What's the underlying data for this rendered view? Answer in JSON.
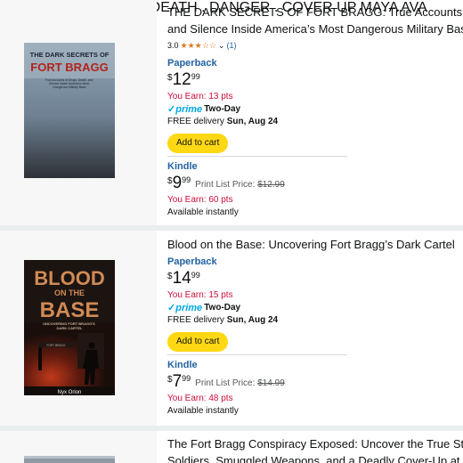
{
  "results": [
    {
      "title": "THE DARK SECRETS OF FORT BRAGG: True Accounts of Dru",
      "title_line2": "and Silence Inside America’s Most Dangerous Military Base",
      "rating": "3.0",
      "review_count": "(1)",
      "cover": {
        "title_line1": "THE DARK SECRETS OF",
        "title_line2": "FORT BRAGG",
        "subtitle": "True Accounts of Drugs, Death, and Silence Inside America's Most Dangerous Military Base",
        "tape_text": "TRESPASS SECRETS DEATH . DANGER . COVER UP",
        "author": "MAYA AVA BENNETT"
      },
      "paperback": {
        "label": "Paperback",
        "currency": "$",
        "whole": "12",
        "fraction": "99",
        "earn": "You Earn: 13 pts",
        "prime_word": "prime",
        "prime_label": "Two-Day",
        "delivery_prefix": "FREE delivery",
        "delivery_date": "Sun, Aug 24",
        "cart_label": "Add to cart"
      },
      "kindle": {
        "label": "Kindle",
        "currency": "$",
        "whole": "9",
        "fraction": "99",
        "list_price_label": "Print List Price:",
        "list_price": "$12.99",
        "earn": "You Earn: 60 pts",
        "availability": "Available instantly"
      }
    },
    {
      "title": "Blood on the Base: Uncovering Fort Bragg’s Dark Cartel",
      "cover": {
        "title_line1": "BLOOD",
        "title_line2": "ON THE",
        "title_line3": "BASE",
        "subtitle": "UNCOVERING FORT BRAGG'S DARK CARTEL",
        "sign": "FORT BRAGG",
        "author": "Nyx Orion"
      },
      "paperback": {
        "label": "Paperback",
        "currency": "$",
        "whole": "14",
        "fraction": "99",
        "earn": "You Earn: 15 pts",
        "prime_word": "prime",
        "prime_label": "Two-Day",
        "delivery_prefix": "FREE delivery",
        "delivery_date": "Sun, Aug 24",
        "cart_label": "Add to cart"
      },
      "kindle": {
        "label": "Kindle",
        "currency": "$",
        "whole": "7",
        "fraction": "99",
        "list_price_label": "Print List Price:",
        "list_price": "$14.99",
        "earn": "You Earn: 48 pts",
        "availability": "Available instantly"
      }
    },
    {
      "title": "The Fort Bragg Conspiracy Exposed: Uncover the True Stor",
      "title_line2": "Soldiers, Smuggled Weapons, and a Deadly Cover-Up at th"
    }
  ]
}
